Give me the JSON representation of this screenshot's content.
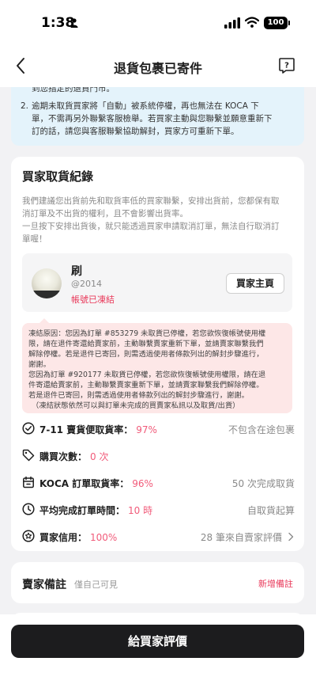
{
  "status_bar": {
    "time": "1:38",
    "battery": "100"
  },
  "nav": {
    "title": "退貨包裹已寄件"
  },
  "notice": {
    "partial_line": "到您指定的退貨門市。",
    "item_number": "2.",
    "item_lines": [
      "逾期未取貨買家將「自動」被系統停權，再也無法在 KOCA 下",
      "單，不需再另外聯繫客服檢舉。若買家主動與您聯繫並願意重新下",
      "訂的話，請您與客服聯繫協助解封，買家方可重新下單。"
    ]
  },
  "pickup_record": {
    "title": "買家取貨紀錄",
    "desc_lines": [
      "我們建議您出貨前先和取貨率低的買家聯繫，安排出貨前，您都保有取",
      "消訂單及不出貨的權利，且不會影響出貨率。",
      "一旦按下安排出貨後，就只能透過買家申請取消訂單，無法自行取消訂",
      "單喔！"
    ],
    "buyer": {
      "name": "刷",
      "handle": "@2014",
      "status": "帳號已凍結",
      "home_button": "買家主頁"
    },
    "alert_lines": [
      "凍結原因：您因為訂單 #853279 未取貨已停權，若您欲恢復帳號使用權",
      "限，請在退件寄還給賣家前，主動聯繫賣家重新下單，並請賣家聯繫我們",
      "解除停權。若是退件已寄回，則需透過使用者條款列出的解封步驟進行，",
      "謝謝。",
      "您因為訂單 #920177 未取貨已停權，若您欲恢復帳號使用權限，請在退",
      "件寄還給賣家前，主動聯繫賣家重新下單，並請賣家聯繫我們解除停權。",
      "若是退件已寄回，則需透過使用者條款列出的解封步驟進行，謝謝。",
      "（凍結狀態依然可以與訂單未完成的買賣家私訊以及取貨/出貨）"
    ],
    "stats": [
      {
        "label": "7-11 賣貨便取貨率：",
        "value": "97%",
        "right": "不包含在途包裹"
      },
      {
        "label": "購買次數：",
        "value": "0 次",
        "right": ""
      },
      {
        "label": "KOCA 訂單取貨率：",
        "value": "96%",
        "right": "50 次完成取貨"
      },
      {
        "label": "平均完成訂單時間：",
        "value": "10 時",
        "right": "自取貨起算"
      },
      {
        "label": "買家信用：",
        "value": "100%",
        "right": "28 筆來自賣家評價"
      }
    ]
  },
  "seller_note": {
    "title": "賣家備註",
    "subtitle": "僅自己可見",
    "add_label": "新增備註"
  },
  "footer": {
    "rate_button": "給買家評價"
  },
  "colors": {
    "accent": "#e93a5b",
    "stat_value": "#f15b7a",
    "notice_bg": "#e4f3fb",
    "alert_bg": "#fde7e7",
    "button_dark": "#1c1c1e"
  },
  "icons": [
    "back-icon",
    "help-icon",
    "check-circle-icon",
    "tag-icon",
    "bag-icon",
    "clock-icon",
    "star-badge-icon",
    "chevron-right-icon"
  ]
}
